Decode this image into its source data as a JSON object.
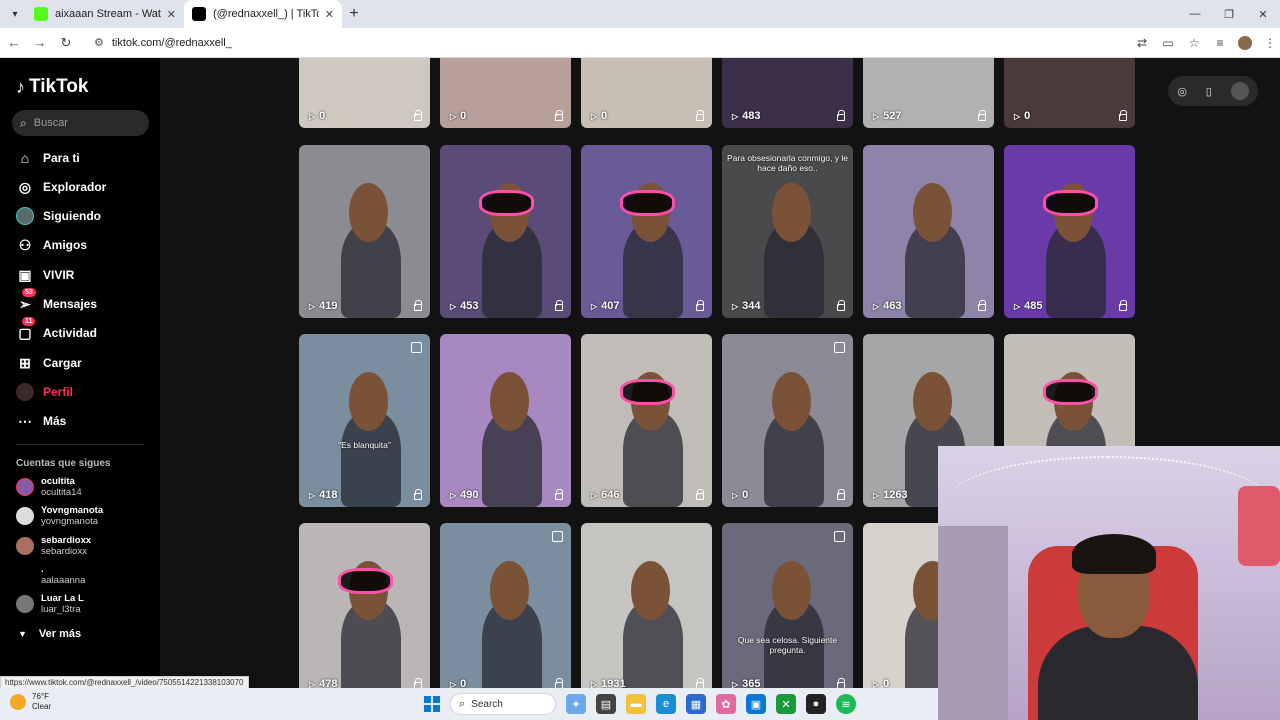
{
  "browser": {
    "tabs": [
      {
        "title": "aixaaan Stream - Watch Live on",
        "favicon_color": "#53fc18",
        "active": false
      },
      {
        "title": "(@rednaxxell_) | TikTok",
        "favicon_color": "#000000",
        "active": true
      }
    ],
    "new_tab": "+",
    "address": "tiktok.com/@rednaxxell_"
  },
  "sidebar": {
    "logo": "TikTok",
    "search_placeholder": "Buscar",
    "nav": [
      {
        "label": "Para ti",
        "icon": "home-icon"
      },
      {
        "label": "Explorador",
        "icon": "compass-icon"
      },
      {
        "label": "Siguiendo",
        "icon": "following-avatar"
      },
      {
        "label": "Amigos",
        "icon": "friends-icon"
      },
      {
        "label": "VIVIR",
        "icon": "live-icon"
      },
      {
        "label": "Mensajes",
        "icon": "messages-icon",
        "badge": "53"
      },
      {
        "label": "Actividad",
        "icon": "activity-icon",
        "badge": "11"
      },
      {
        "label": "Cargar",
        "icon": "upload-icon"
      },
      {
        "label": "Perfil",
        "icon": "profile-avatar",
        "accent": "#fe2c55"
      },
      {
        "label": "Más",
        "icon": "more-icon"
      }
    ],
    "following_heading": "Cuentas que sigues",
    "accounts": [
      {
        "name": "ocultita",
        "handle": "ocultita14",
        "color": "#8a5aa8"
      },
      {
        "name": "Yovngmanota",
        "handle": "yovngmanota",
        "color": "#dcdcdc"
      },
      {
        "name": "sebardioxx",
        "handle": "sebardioxx",
        "color": "#a87060"
      },
      {
        "name": ".",
        "handle": "aalaaanna",
        "color": ""
      },
      {
        "name": "Luar La L",
        "handle": "luar_l3tra",
        "color": "#777777"
      }
    ],
    "see_more": "Ver más"
  },
  "videos": [
    {
      "views": "0",
      "bg": "#cfc8c0",
      "row": 0,
      "col": 0
    },
    {
      "views": "0",
      "bg": "#b8a09a",
      "row": 0,
      "col": 1
    },
    {
      "views": "0",
      "bg": "#c8beb4",
      "row": 0,
      "col": 2
    },
    {
      "views": "483",
      "bg": "#3c2f4a",
      "row": 0,
      "col": 3
    },
    {
      "views": "527",
      "bg": "#b2b0b0",
      "row": 0,
      "col": 4
    },
    {
      "views": "0",
      "bg": "#4a3a3a",
      "row": 0,
      "col": 5
    },
    {
      "views": "419",
      "bg": "#8a8c92",
      "row": 1,
      "col": 0
    },
    {
      "views": "453",
      "bg": "#5a4b78",
      "row": 1,
      "col": 1,
      "masked": true
    },
    {
      "views": "407",
      "bg": "#6a5a98",
      "row": 1,
      "col": 2,
      "masked": true
    },
    {
      "views": "344",
      "bg": "#4a4a4c",
      "row": 1,
      "col": 3,
      "caption": "Para obsesionarla conmigo, y le hace daño eso.."
    },
    {
      "views": "463",
      "bg": "#8e84aa",
      "row": 1,
      "col": 4
    },
    {
      "views": "485",
      "bg": "#6a3aa8",
      "row": 1,
      "col": 5,
      "masked": true
    },
    {
      "views": "418",
      "bg": "#7a8ea0",
      "row": 2,
      "col": 0,
      "multi": true,
      "caption": "\"Es blanquita\""
    },
    {
      "views": "490",
      "bg": "#a888c0",
      "row": 2,
      "col": 1
    },
    {
      "views": "646",
      "bg": "#c0bcb8",
      "row": 2,
      "col": 2,
      "masked": true
    },
    {
      "views": "0",
      "bg": "#8c8a94",
      "row": 2,
      "col": 3,
      "multi": true
    },
    {
      "views": "1263",
      "bg": "#a4a6a8",
      "row": 2,
      "col": 4
    },
    {
      "views": "",
      "bg": "#c2bdb6",
      "row": 2,
      "col": 5,
      "masked": true
    },
    {
      "views": "478",
      "bg": "#bab6b6",
      "row": 3,
      "col": 0,
      "masked": true
    },
    {
      "views": "0",
      "bg": "#7a8ea0",
      "row": 3,
      "col": 1,
      "multi": true
    },
    {
      "views": "1931",
      "bg": "#c6c4c0",
      "row": 3,
      "col": 2
    },
    {
      "views": "365",
      "bg": "#6a6a7a",
      "row": 3,
      "col": 3,
      "multi": true,
      "caption": "Que sea celosa. Siguiente pregunta."
    },
    {
      "views": "0",
      "bg": "#d8d2cc",
      "row": 3,
      "col": 4
    }
  ],
  "status_link": "https://www.tiktok.com/@rednaxxell_/video/7505514221338103070",
  "taskbar": {
    "temp": "76°F",
    "condition": "Clear",
    "search": "Search"
  }
}
